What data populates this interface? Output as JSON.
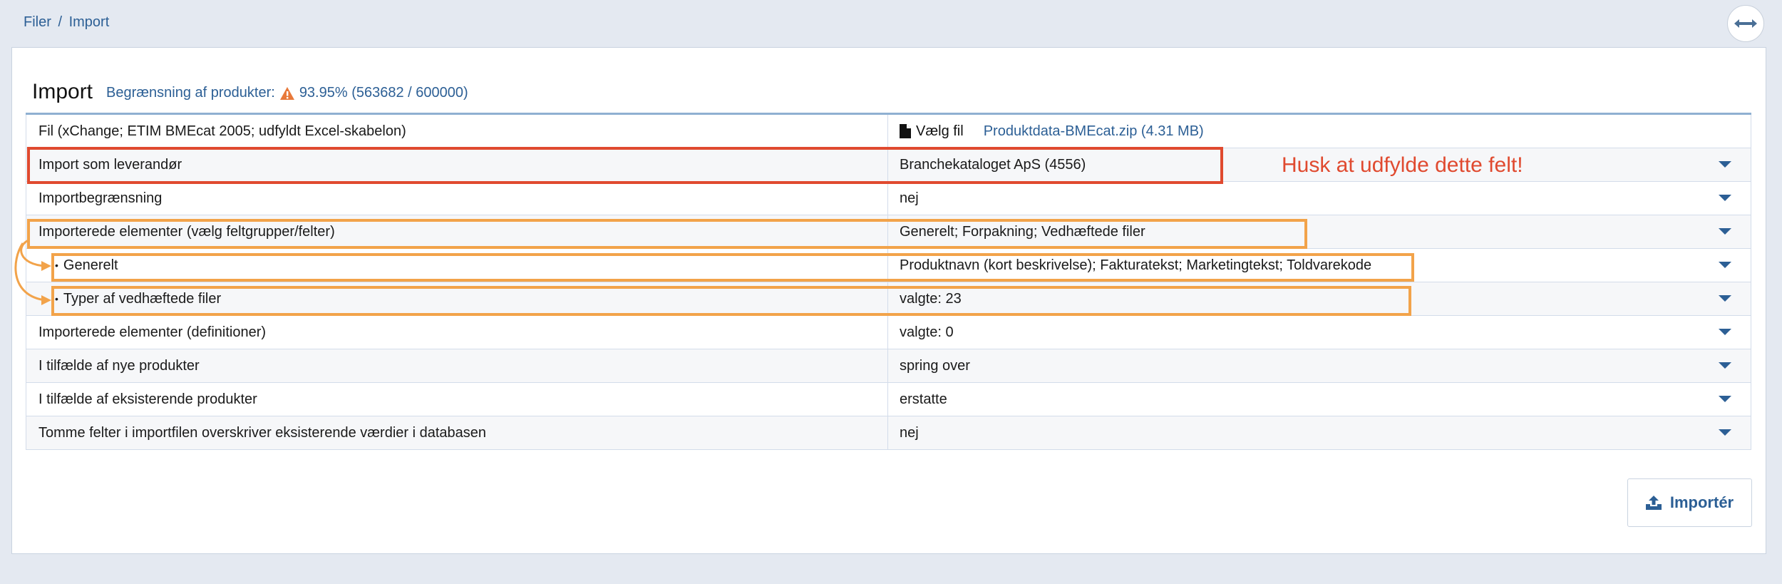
{
  "breadcrumb": {
    "part1": "Filer",
    "separator": "/",
    "part2": "Import"
  },
  "page": {
    "title": "Import",
    "limit_label": "Begrænsning af produkter:",
    "limit_value": "93.95% (563682 / 600000)"
  },
  "file_row": {
    "label": "Fil (xChange; ETIM BMEcat 2005; udfyldt Excel-skabelon)",
    "choose_label": "Vælg fil",
    "file_name": "Produktdata-BMEcat.zip (4.31 MB)"
  },
  "rows": [
    {
      "label": "Import som leverandør",
      "value": "Branchekataloget ApS (4556)"
    },
    {
      "label": "Importbegrænsning",
      "value": "nej"
    },
    {
      "label": "Importerede elementer (vælg feltgrupper/felter)",
      "value": "Generelt; Forpakning; Vedhæftede filer"
    },
    {
      "label": "Generelt",
      "value": "Produktnavn (kort beskrivelse); Fakturatekst; Marketingtekst; Toldvarekode"
    },
    {
      "label": "Typer af vedhæftede filer",
      "value": "valgte: 23"
    },
    {
      "label": "Importerede elementer (definitioner)",
      "value": "valgte: 0"
    },
    {
      "label": "I tilfælde af nye produkter",
      "value": "spring over"
    },
    {
      "label": "I tilfælde af eksisterende produkter",
      "value": "erstatte"
    },
    {
      "label": "Tomme felter i importfilen overskriver eksisterende værdier i databasen",
      "value": "nej"
    }
  ],
  "annotation": {
    "note": "Husk at udfylde dette felt!"
  },
  "actions": {
    "import_label": "Importér"
  },
  "colors": {
    "accent": "#2c5f95",
    "annotation_red": "#e04a2f",
    "annotation_orange": "#f2a34a",
    "warning": "#e8793a"
  }
}
